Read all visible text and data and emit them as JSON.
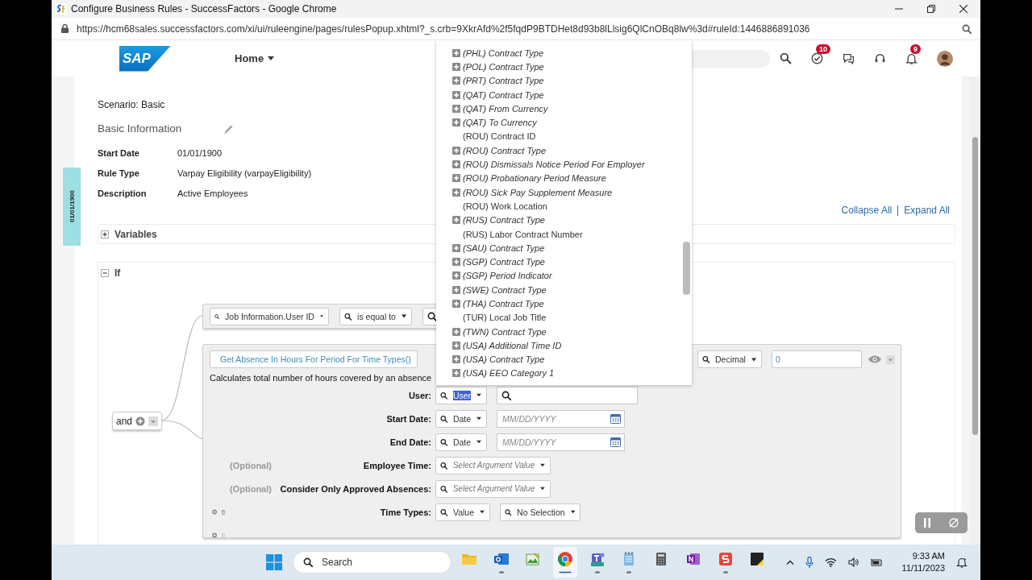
{
  "window": {
    "title": "Configure Business Rules - SuccessFactors - Google Chrome"
  },
  "address_bar": {
    "url": "https://hcm68sales.successfactors.com/xi/ui/ruleengine/pages/rulesPopup.xhtml?_s.crb=9XkrAfd%2f5fqdP9BTDHet8d93b8lLlsig6QlCnOBq8lw%3d#ruleId:1446886891036"
  },
  "header": {
    "logo": "SAP",
    "nav": "Home",
    "icons": [
      {
        "kind": "search"
      },
      {
        "kind": "approvals",
        "badge": "10"
      },
      {
        "kind": "chat"
      },
      {
        "kind": "support"
      },
      {
        "kind": "notifications",
        "badge": "9"
      },
      {
        "kind": "avatar"
      }
    ]
  },
  "rule": {
    "scenario": "Scenario: Basic",
    "info_title": "Basic Information",
    "effective_date": "01/01/1900",
    "fields": [
      {
        "label": "Start Date",
        "value": "01/01/1900"
      },
      {
        "label": "Rule Type",
        "value": "Varpay Eligibility (varpayEligibility)"
      },
      {
        "label": "Description",
        "value": "Active Employees"
      }
    ],
    "actions": [
      "Collapse All",
      "Expand All"
    ],
    "sections": [
      {
        "title": "Variables",
        "expanded": false
      },
      {
        "title": "If",
        "expanded": true
      }
    ]
  },
  "canvas": {
    "operator": "and",
    "conditions": [
      {
        "kind": "comparison",
        "left": "Job Information.User ID",
        "operator": "is equal to"
      },
      {
        "kind": "function",
        "function": "Get Absence In Hours For Period For Time Types()",
        "description": "Calculates total number of hours covered by an absence",
        "result_type": "Decimal",
        "result_value": "0",
        "parameters": [
          {
            "label": "User:",
            "controls": [
              {
                "kind": "select",
                "value": "User",
                "highlighted": true
              },
              {
                "kind": "search_field"
              }
            ]
          },
          {
            "label": "Start Date:",
            "controls": [
              {
                "kind": "select",
                "value": "Date",
                "highlighted": false
              },
              {
                "kind": "date",
                "placeholder": "MM/DD/YYYY"
              }
            ]
          },
          {
            "label": "End Date:",
            "controls": [
              {
                "kind": "select",
                "value": "Date",
                "highlighted": false
              },
              {
                "kind": "date",
                "placeholder": "MM/DD/YYYY"
              }
            ]
          },
          {
            "prefix": "(Optional)",
            "label": "Employee Time:",
            "controls": [
              {
                "kind": "select",
                "placeholder": "Select Argument Value"
              }
            ]
          },
          {
            "prefix": "(Optional)",
            "label": "Consider Only Approved Absences:",
            "controls": [
              {
                "kind": "select",
                "placeholder": "Select Argument Value"
              }
            ]
          },
          {
            "label": "Time Types:",
            "controls": [
              {
                "kind": "select",
                "value": "Value",
                "highlighted": false
              },
              {
                "kind": "select",
                "value": "No Selection",
                "highlighted": false
              }
            ]
          }
        ],
        "row_actions": [
          {
            "trash_disabled": false
          },
          {
            "trash_disabled": true
          }
        ]
      }
    ]
  },
  "dropdown": {
    "items": [
      {
        "label": "(PHL) Contract Type",
        "kind": "expandable"
      },
      {
        "label": "(POL) Contract Type",
        "kind": "expandable"
      },
      {
        "label": "(PRT) Contract Type",
        "kind": "expandable"
      },
      {
        "label": "(QAT) Contract Type",
        "kind": "expandable"
      },
      {
        "label": "(QAT) From Currency",
        "kind": "expandable"
      },
      {
        "label": "(QAT) To Currency",
        "kind": "expandable"
      },
      {
        "label": "(ROU) Contract ID",
        "kind": "leaf"
      },
      {
        "label": "(ROU) Contract Type",
        "kind": "expandable"
      },
      {
        "label": "(ROU) Dismissals Notice Period For Employer",
        "kind": "expandable"
      },
      {
        "label": "(ROU) Probationary Period Measure",
        "kind": "expandable"
      },
      {
        "label": "(ROU) Sick Pay Supplement Measure",
        "kind": "expandable"
      },
      {
        "label": "(ROU) Work Location",
        "kind": "leaf"
      },
      {
        "label": "(RUS) Contract Type",
        "kind": "expandable"
      },
      {
        "label": "(RUS) Labor Contract Number",
        "kind": "leaf"
      },
      {
        "label": "(SAU) Contract Type",
        "kind": "expandable"
      },
      {
        "label": "(SGP) Contract Type",
        "kind": "expandable"
      },
      {
        "label": "(SGP) Period Indicator",
        "kind": "expandable"
      },
      {
        "label": "(SWE) Contract Type",
        "kind": "expandable"
      },
      {
        "label": "(THA) Contract Type",
        "kind": "expandable"
      },
      {
        "label": "(TUR) Local Job Title",
        "kind": "leaf"
      },
      {
        "label": "(TWN) Contract Type",
        "kind": "expandable"
      },
      {
        "label": "(USA) Additional Time ID",
        "kind": "expandable"
      },
      {
        "label": "(USA) Contract Type",
        "kind": "expandable"
      },
      {
        "label": "(USA) EEO Category 1",
        "kind": "expandable"
      }
    ]
  },
  "taskbar": {
    "search_placeholder": "Search",
    "apps": [
      {
        "kind": "folder",
        "running": false,
        "selected": false
      },
      {
        "kind": "mail",
        "running": true,
        "selected": false
      },
      {
        "kind": "paint",
        "running": false,
        "selected": false
      },
      {
        "kind": "browser",
        "running": true,
        "selected": true
      },
      {
        "kind": "teams",
        "running": true,
        "selected": false
      },
      {
        "kind": "notepad",
        "running": true,
        "selected": false
      },
      {
        "kind": "calculator",
        "running": false,
        "selected": false
      },
      {
        "kind": "notes",
        "running": false,
        "selected": false
      },
      {
        "kind": "red-app",
        "running": true,
        "selected": false
      },
      {
        "kind": "sticky",
        "running": false,
        "selected": false
      }
    ],
    "time": "9:33 AM",
    "date": "11/11/2023"
  }
}
